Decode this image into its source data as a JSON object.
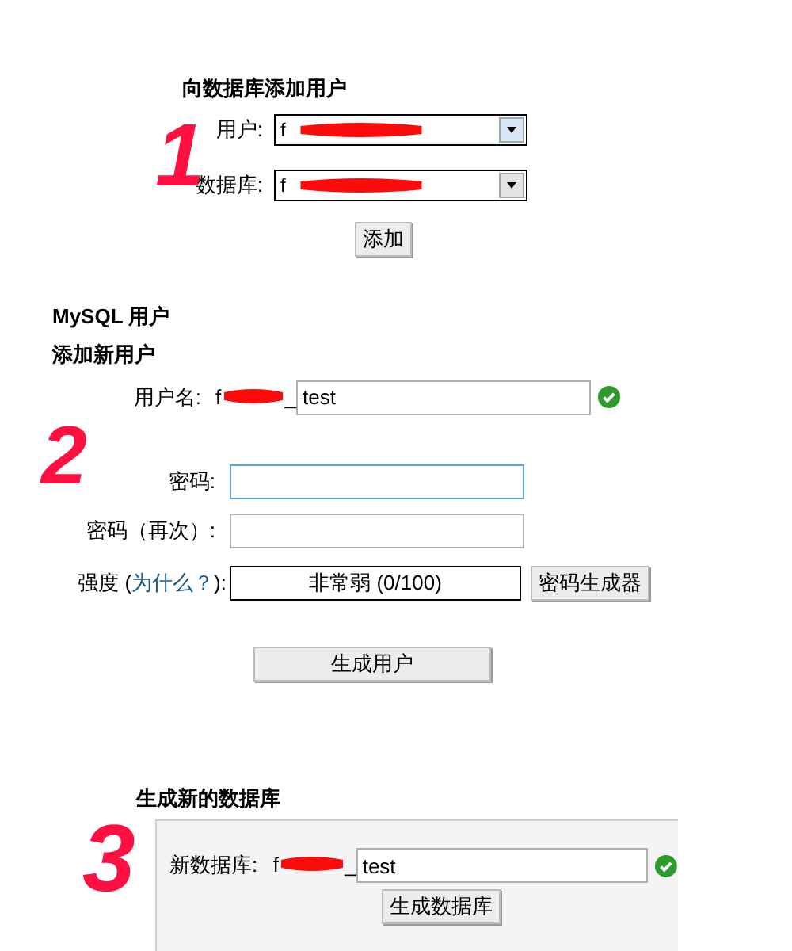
{
  "add_user_to_db": {
    "title": "向数据库添加用户",
    "fields": [
      {
        "label": "用户:",
        "value": "f"
      },
      {
        "label": "数据库:",
        "value": "f"
      }
    ],
    "button": "添加"
  },
  "mysql_users": {
    "title": "MySQL 用户",
    "subtitle": "添加新用户",
    "username": {
      "label": "用户名:",
      "prefix_start": "f",
      "prefix_end": "_",
      "value": "test",
      "valid": true
    },
    "password": {
      "label": "密码:",
      "focused": true
    },
    "password_again": {
      "label": "密码（再次）:",
      "focused": false
    },
    "strength": {
      "label_start": "强度 (",
      "link": "为什么？",
      "label_end": "):",
      "value": "非常弱 (0/100)"
    },
    "generator_button": "密码生成器",
    "create_button": "生成用户"
  },
  "new_database": {
    "title": "生成新的数据库",
    "label": "新数据库:",
    "prefix_start": "f",
    "prefix_end": "_",
    "value": "test",
    "valid": true,
    "button": "生成数据库"
  },
  "annotations": [
    {
      "text": "1"
    },
    {
      "text": "2"
    },
    {
      "text": "3"
    }
  ]
}
